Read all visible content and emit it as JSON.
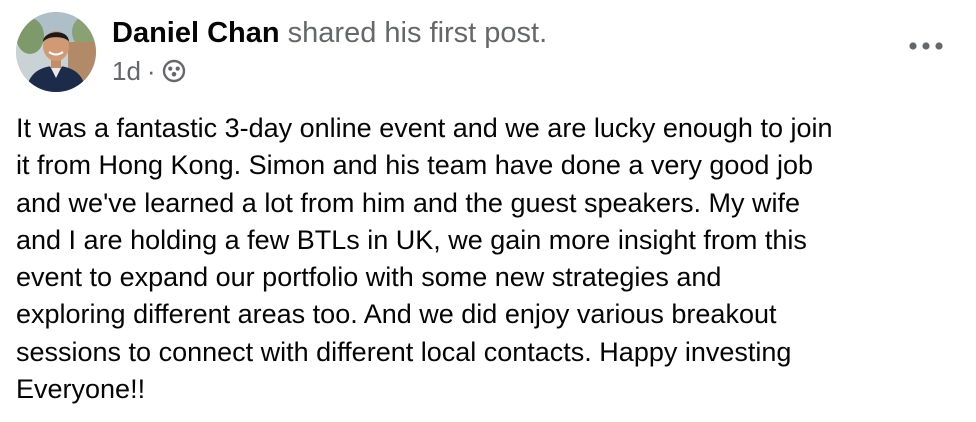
{
  "post": {
    "author": "Daniel Chan",
    "action": "shared his first post.",
    "time": "1d",
    "separator": "·",
    "audience_icon": "friends-group-icon",
    "more_icon": "more-horizontal-icon",
    "body_lines": [
      "It was a fantastic 3-day online event and we are lucky enough to join",
      "it from Hong Kong. Simon and his team have done a very good job",
      "and we've learned a lot from him and the guest speakers.  My wife",
      "and I are holding a few BTLs in UK, we gain more insight from this",
      "event to expand our portfolio with some new strategies and",
      "exploring different areas too. And we did enjoy various breakout",
      "sessions to connect with different local contacts. Happy investing",
      "Everyone!!"
    ]
  },
  "colors": {
    "text_primary": "#050505",
    "text_secondary": "#65676b",
    "background": "#ffffff"
  }
}
